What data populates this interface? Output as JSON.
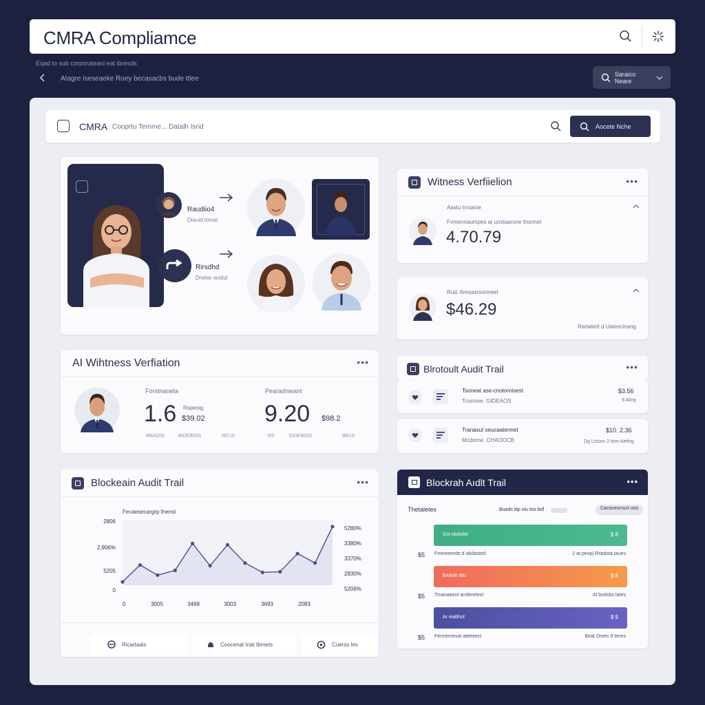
{
  "topbar": {
    "title": "CMRA Compliamce"
  },
  "subnav": {
    "line1": "Eqad to sub corporateasl eat ibresds",
    "line2": "Atagre iseseaeke Roey becasacbs bude ttlee",
    "chip_label": "Saraico Neare"
  },
  "inner_bar": {
    "title": "CMRA",
    "subtitle": "Cooprtu Temme... Datalh Isrid",
    "button_label": "Aocete Nche"
  },
  "flow": {
    "row1_title": "Raudiio4",
    "row1_sub": "Diauid iomat",
    "row2_title": "Rirsdhd",
    "row2_sub": "Dnelar wodul"
  },
  "witness_card": {
    "title": "Witness Verfiielion",
    "label": "Aastu trroanie",
    "desc": "Fvmennaumpes at uostaarone thonnet",
    "value": "4.70.79"
  },
  "assessment_card": {
    "label": "Rud. Aresasrsonneet",
    "value": "$46.29",
    "footnote": "Ranaliett d Uatescinang"
  },
  "ai_card": {
    "title": "AI Wihtness Verfiation",
    "col1_label": "Forstnaneta",
    "col1_value": "1.6",
    "col1_sub_top": "Rapesig",
    "col1_sub_val": "$39.02",
    "col1_foot_a": "RRAOIS",
    "col1_foot_b": "BIDEBOIS",
    "col1_foot_c": "RO.IS",
    "col2_label": "Pearadnieant",
    "col2_value": "9.20",
    "col2_sub_val": "$98.2",
    "col2_foot_a": "RS",
    "col2_foot_b": "EIDEBOIS",
    "col2_foot_c": "BR1S"
  },
  "audit_small": {
    "title": "Blrotoult Audit Trail",
    "items": [
      {
        "title": "Tsoneat ase-cnotornisest",
        "sub": "Tcorrove. GIDEAOS",
        "amount": "$3.56",
        "note": "9.Abrg"
      },
      {
        "title": "Tranasut seucaatennet",
        "sub": "Mcdorne. CHAOOCB",
        "amount": "$10. 2.36",
        "note": "Dg Ltsses 2 tom-Aeting"
      }
    ]
  },
  "chart_card": {
    "title": "Blockeain Audit Trail",
    "legend_btns": [
      "Ricartaals",
      "Coocenat Inat tbmets",
      "Cuerss les"
    ]
  },
  "chart_data": {
    "type": "line",
    "title": "Fecaesecargrp thenst",
    "y_left_ticks": [
      "2806",
      "2,906%",
      "5205",
      "0"
    ],
    "y_right_ticks": [
      "5280%",
      "3380%",
      "3370%",
      "2830%",
      "5206%"
    ],
    "x_ticks": [
      "0",
      "3005",
      "3468",
      "3003",
      "3693",
      "2083"
    ],
    "x": [
      0,
      1,
      2,
      3,
      4,
      5,
      6,
      7,
      8,
      9,
      10,
      11,
      12
    ],
    "values": [
      50,
      300,
      150,
      220,
      620,
      290,
      600,
      330,
      190,
      200,
      470,
      330,
      870
    ]
  },
  "bar_card": {
    "title": "Blockrah Aıdlt Trail",
    "head_left": "Thetaletex",
    "head_mid": "Buads itip olu too biđ",
    "head_badge": "Cacscescruct oos",
    "rows": [
      {
        "label": "Gst ebdsliet",
        "value": "$ 8",
        "fill": 1.0,
        "color": "#3fae84",
        "color2": "#4cba8f",
        "meta_left": "$5",
        "meta_mid": "Fmmeerede d obdasted.",
        "meta_right": "2 at peop| Rsedsta taues"
      },
      {
        "label": "Eedsle tillo",
        "value": "$ 8",
        "fill": 1.0,
        "color": "#ef6a5e",
        "color2": "#f59a4a",
        "meta_left": "$5",
        "meta_mid": "Tmanaeent arrderetest",
        "meta_right": "At bodsbs tates"
      },
      {
        "label": "Ar eiabhot",
        "value": "$ 9",
        "fill": 1.0,
        "color": "#4b4f9e",
        "color2": "#6a62c2",
        "meta_left": "$5",
        "meta_mid": "Fenneroesat atteteect.",
        "meta_right": "Beat Onets 9 times"
      }
    ]
  }
}
